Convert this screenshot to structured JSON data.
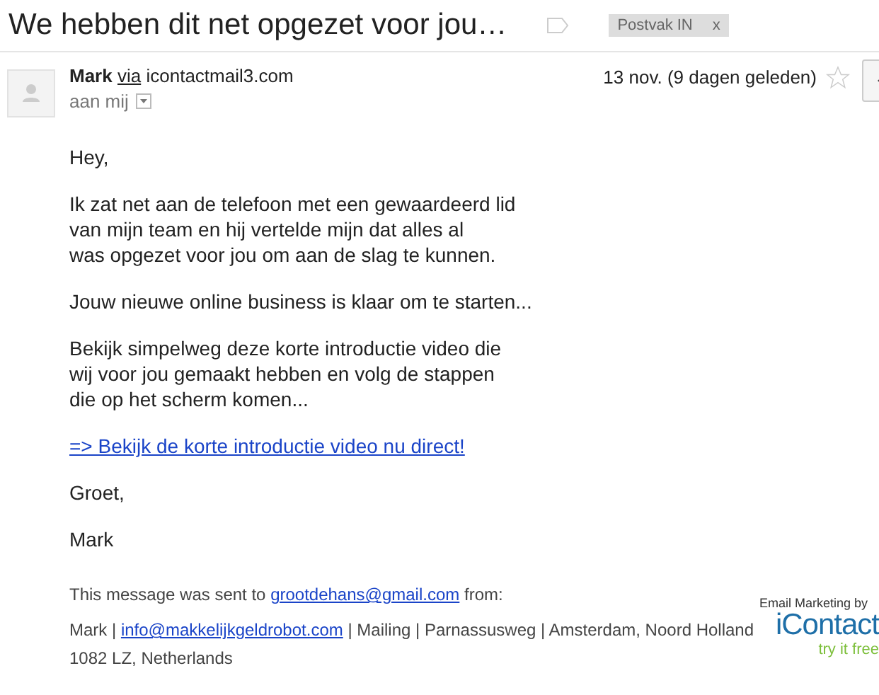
{
  "subject": "We hebben dit net opgezet voor jou…",
  "label": {
    "text": "Postvak IN",
    "close": "x"
  },
  "message": {
    "sender": "Mark",
    "via": "via",
    "domain": "icontactmail3.com",
    "recipient": "aan mij",
    "date": "13 nov. (9 dagen geleden)",
    "starred": false
  },
  "body": [
    {
      "kind": "text",
      "text": "Hey,"
    },
    {
      "kind": "text",
      "lines": [
        "Ik zat net aan de telefoon met een gewaardeerd lid",
        "van mijn team en hij vertelde mijn dat alles al",
        "was opgezet voor jou om aan de slag te kunnen."
      ]
    },
    {
      "kind": "text",
      "text": "Jouw nieuwe online business is klaar om te starten..."
    },
    {
      "kind": "text",
      "lines": [
        "Bekijk simpelweg deze korte introductie video die",
        "wij voor jou gemaakt hebben en volg de stappen",
        "die op het scherm komen..."
      ]
    },
    {
      "kind": "link",
      "text": "=> Bekijk de korte introductie video nu direct!"
    },
    {
      "kind": "text",
      "text": "Groet,"
    },
    {
      "kind": "text",
      "text": "Mark"
    }
  ],
  "footer": {
    "sent_before": "This message was sent to",
    "sent_email": "grootdehans@gmail.com",
    "sent_after": "from:",
    "sender": "Mark |",
    "sender_email": "info@makkelijkgeldrobot.com",
    "address": "| Mailing | Parnassusweg | Amsterdam, Noord Holland",
    "address_line2": "1082 LZ, Netherlands"
  },
  "badge": {
    "caption": "Email Marketing by",
    "logo": "iContact",
    "cta": "try it free"
  }
}
